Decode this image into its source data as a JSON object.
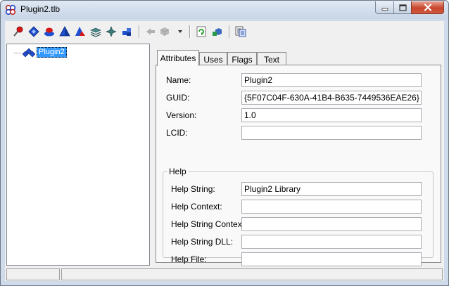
{
  "window": {
    "title": "Plugin2.tlb",
    "colors": {
      "accent": "#3399ff",
      "close_button": "#c7452c",
      "frame": "#cfdaea"
    }
  },
  "toolbar": {
    "buttons": [
      {
        "icon": "red-pin-icon"
      },
      {
        "icon": "blue-diamond-icon"
      },
      {
        "icon": "red-blue-stack-icon"
      },
      {
        "icon": "blue-pyramid-icon"
      },
      {
        "icon": "red-blue-pyramid-icon"
      },
      {
        "icon": "layers-icon"
      },
      {
        "icon": "compass-star-icon"
      },
      {
        "icon": "blue-cubes-icon"
      },
      {
        "icon": "back-arrow-disabled-icon"
      },
      {
        "icon": "gray-cube-disabled-icon"
      },
      {
        "icon": "dropdown-arrow-icon"
      },
      {
        "icon": "refresh-icon"
      },
      {
        "icon": "cube-tool-icon"
      },
      {
        "icon": "properties-sheet-icon"
      }
    ]
  },
  "tree": {
    "items": [
      {
        "label": "Plugin2",
        "icon": "library-icon",
        "selected": true
      }
    ]
  },
  "tabs": [
    {
      "label": "Attributes",
      "active": true
    },
    {
      "label": "Uses"
    },
    {
      "label": "Flags"
    },
    {
      "label": "Text"
    }
  ],
  "attributes": {
    "name": {
      "label": "Name:",
      "value": "Plugin2"
    },
    "guid": {
      "label": "GUID:",
      "value": "{5F07C04F-630A-41B4-B635-7449536EAE26}"
    },
    "version": {
      "label": "Version:",
      "value": "1.0"
    },
    "lcid": {
      "label": "LCID:",
      "value": ""
    }
  },
  "help": {
    "group_title": "Help",
    "help_string": {
      "label": "Help String:",
      "value": "Plugin2 Library"
    },
    "help_context": {
      "label": "Help Context:",
      "value": ""
    },
    "help_string_context": {
      "label": "Help String Context:",
      "value": ""
    },
    "help_string_dll": {
      "label": "Help String DLL:",
      "value": ""
    },
    "help_file": {
      "label": "Help File:",
      "value": ""
    }
  }
}
